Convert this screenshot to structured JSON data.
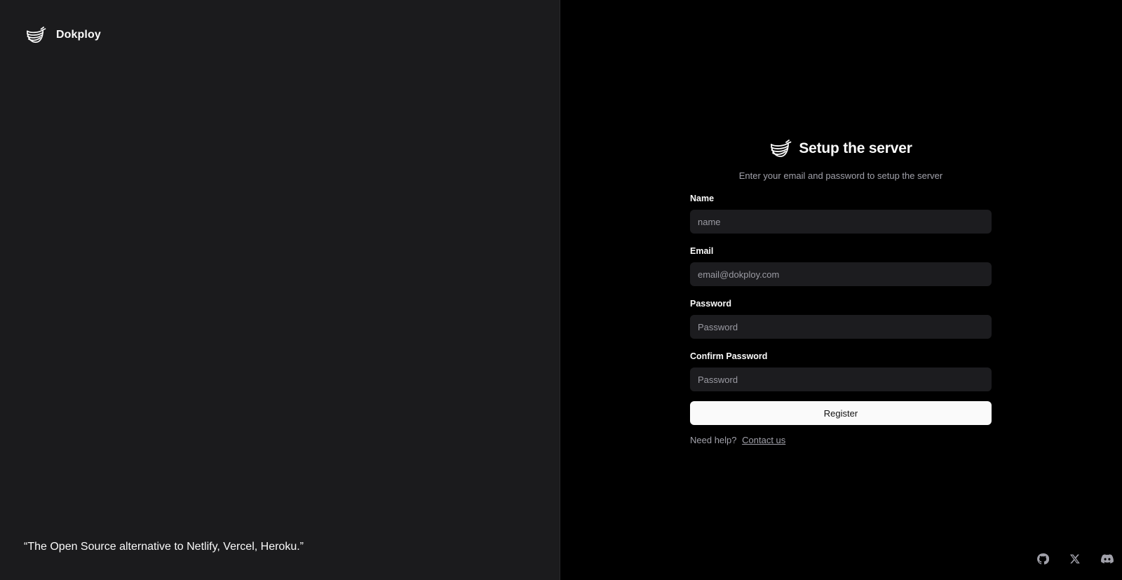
{
  "brand": {
    "name": "Dokploy",
    "logo_icon": "dokploy-whale-icon"
  },
  "left": {
    "quote": "“The Open Source alternative to Netlify, Vercel, Heroku.”"
  },
  "form": {
    "title": "Setup the server",
    "subtitle": "Enter your email and password to setup the server",
    "fields": [
      {
        "label": "Name",
        "placeholder": "name",
        "value": ""
      },
      {
        "label": "Email",
        "placeholder": "email@dokploy.com",
        "value": ""
      },
      {
        "label": "Password",
        "placeholder": "Password",
        "value": ""
      },
      {
        "label": "Confirm Password",
        "placeholder": "Password",
        "value": ""
      }
    ],
    "submit_label": "Register",
    "help_text": "Need help?",
    "help_link": "Contact us"
  },
  "socials": [
    {
      "icon": "github-icon"
    },
    {
      "icon": "x-twitter-icon"
    },
    {
      "icon": "discord-icon"
    }
  ],
  "colors": {
    "left_bg": "#1b1b1d",
    "right_bg": "#000000",
    "input_bg": "#1c1c1f",
    "button_bg": "#fafafa",
    "muted_text": "#a1a1aa"
  }
}
